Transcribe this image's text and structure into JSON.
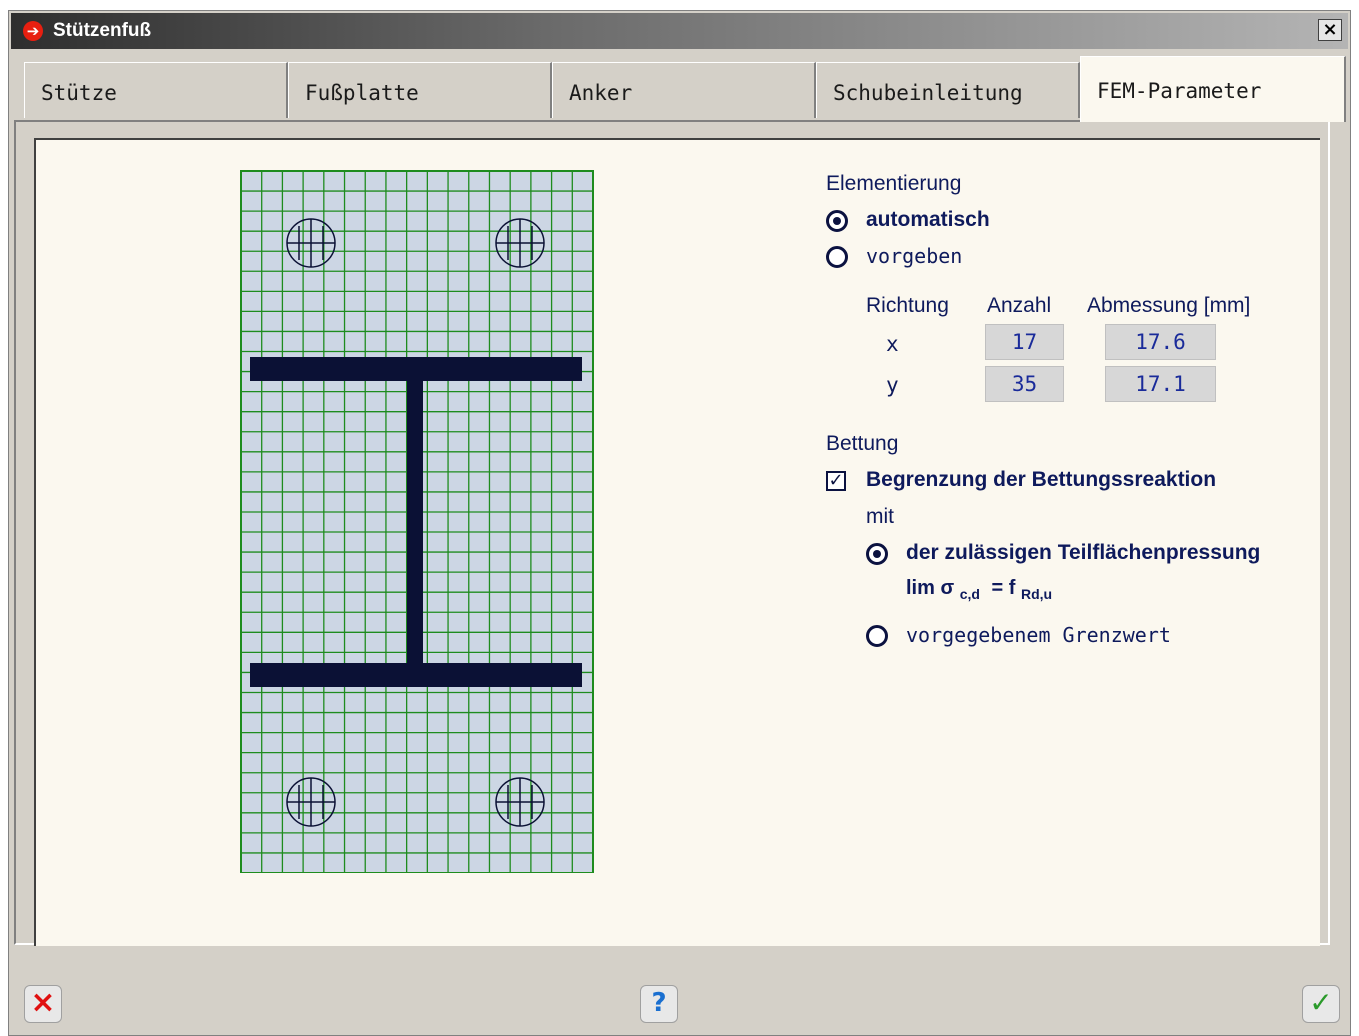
{
  "window": {
    "title": "Stützenfuß",
    "close_label": "×"
  },
  "tabs": [
    {
      "label": "Stütze",
      "active": false
    },
    {
      "label": "Fußplatte",
      "active": false
    },
    {
      "label": "Anker",
      "active": false
    },
    {
      "label": "Schubeinleitung",
      "active": false
    },
    {
      "label": "FEM-Parameter",
      "active": true
    }
  ],
  "mesh": {
    "nx": 17,
    "ny": 35
  },
  "elementierung": {
    "heading": "Elementierung",
    "option_auto": "automatisch",
    "option_manual": "vorgeben",
    "selected": "automatisch",
    "table": {
      "headers": [
        "Richtung",
        "Anzahl",
        "Abmessung [mm]"
      ],
      "rows": [
        {
          "dir": "x",
          "count": "17",
          "size": "17.6"
        },
        {
          "dir": "y",
          "count": "35",
          "size": "17.1"
        }
      ]
    }
  },
  "bettung": {
    "heading": "Bettung",
    "checkbox_label": "Begrenzung der Bettungssreaktion",
    "checked": true,
    "mit": "mit",
    "option_1": "der zulässigen Teilflächenpressung",
    "formula": {
      "lim": "lim σ",
      "sub1": "c,d",
      "eq": "= f",
      "sub2": "Rd,u"
    },
    "option_2": "vorgegebenem Grenzwert",
    "selected": 1
  },
  "footer": {
    "cancel": "×",
    "help": "?",
    "ok": "✓"
  },
  "colors": {
    "mesh_line": "#1e8c1e",
    "mesh_fill": "#ccd6e4",
    "steel": "#0b1135",
    "label": "#0e1a5c"
  }
}
